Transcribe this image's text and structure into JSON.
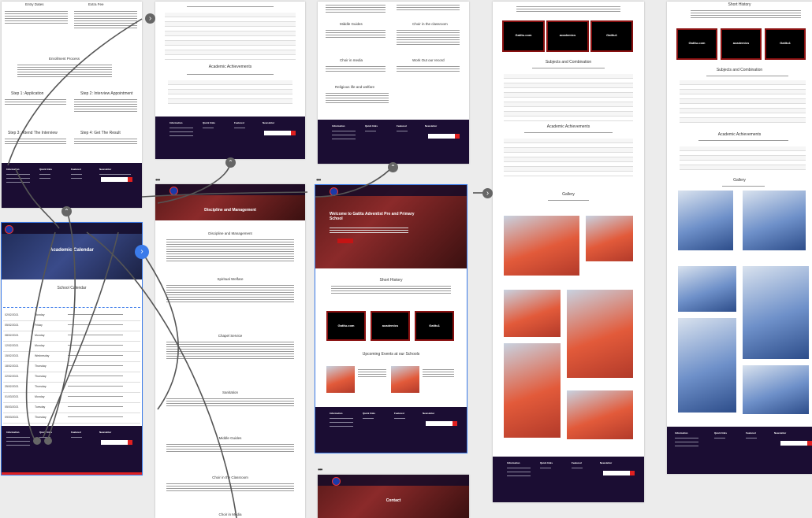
{
  "frames": {
    "enrollment": {
      "col1_title": "Entry Dates",
      "col2_title": "Extra Fee",
      "process_title": "Enrollment Process",
      "step1": "Step 1: Application",
      "step2": "Step 2: Interview Appointment",
      "step3": "Step 3: Attend The Interview",
      "step4": "Step 4: Get The Result"
    },
    "calendar": {
      "hero_title": "Academic Calendar",
      "section_title": "School Calendar",
      "rows": [
        {
          "date": "02/02/2021",
          "day": "Monday"
        },
        {
          "date": "05/02/2021",
          "day": "Friday"
        },
        {
          "date": "08/02/2021",
          "day": "Monday"
        },
        {
          "date": "12/02/2021",
          "day": "Monday"
        },
        {
          "date": "15/02/2021",
          "day": "Wednesday"
        },
        {
          "date": "18/02/2021",
          "day": "Thursday"
        },
        {
          "date": "22/02/2021",
          "day": "Thursday"
        },
        {
          "date": "25/02/2021",
          "day": "Thursday"
        },
        {
          "date": "01/03/2021",
          "day": "Monday"
        },
        {
          "date": "05/03/2021",
          "day": "Tuesday"
        },
        {
          "date": "09/03/2021",
          "day": "Thursday"
        },
        {
          "date": "12/03/2021",
          "day": "Thursday-Saturday"
        }
      ]
    },
    "academics": {
      "title": "Academic Achievements"
    },
    "discipline": {
      "hero_title": "Discipline and Management",
      "sections": [
        "Discipline and Management",
        "Spiritual Welfare",
        "Chapel Service",
        "Sanitation",
        "Middle Guides",
        "Choir in the Classroom",
        "Choir in Media"
      ]
    },
    "extras": {
      "col_left": [
        "Middle Guides",
        "Choir in media",
        "Religious life and welfare"
      ],
      "col_right": [
        "Choir in the classroom",
        "Work Out our record"
      ]
    },
    "home": {
      "hero_title": "Welcome to Gatitu Adventist Pre and Primary School",
      "history_title": "Short History",
      "cards": [
        "Gatitu.com",
        "academics",
        "Gatitu1"
      ],
      "events_title": "Upcoming Events at our Schools"
    },
    "gallery": {
      "cards": [
        "Gatitu.com",
        "academics",
        "Gatitu1"
      ],
      "subjects_title": "Subjects and Combination",
      "achievements_title": "Academic Achievements",
      "gallery_title": "Gallery"
    },
    "history": {
      "title": "Short History",
      "cards": [
        "Gatitu.com",
        "academics",
        "Gatitu1"
      ],
      "subjects_title": "Subjects and Combination",
      "achievements_title": "Academic Achievements",
      "gallery_title": "Gallery"
    },
    "contact": {
      "hero_title": "Contact"
    }
  },
  "footer": {
    "col1": "Information",
    "col2": "Quick links",
    "col3": "Featured",
    "col4": "Newsletter"
  },
  "colors": {
    "footer": "#1b0d33",
    "accent": "#e02020",
    "link": "#555555",
    "selection": "#3b7bea"
  }
}
